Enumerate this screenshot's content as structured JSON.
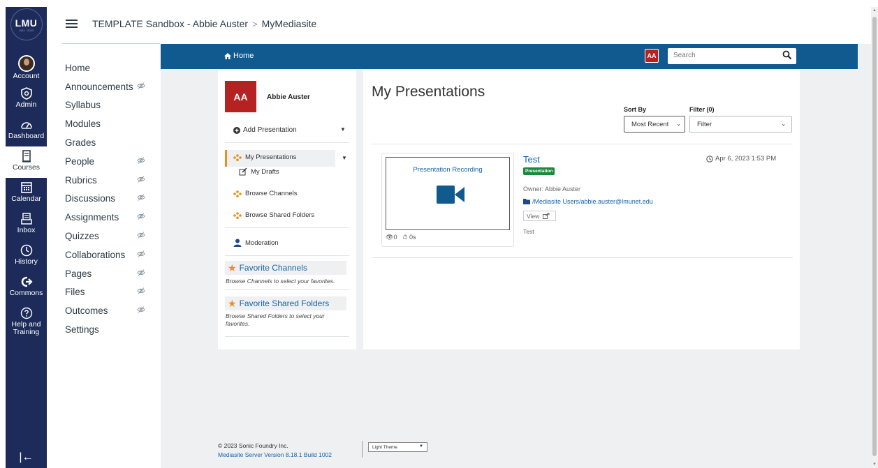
{
  "global_nav": {
    "logo": {
      "text": "LMU",
      "year": "1911 · 2023"
    },
    "items": [
      {
        "label": "Account",
        "icon": "avatar-icon"
      },
      {
        "label": "Admin",
        "icon": "shield-icon"
      },
      {
        "label": "Dashboard",
        "icon": "dashboard-icon"
      },
      {
        "label": "Courses",
        "icon": "book-icon"
      },
      {
        "label": "Calendar",
        "icon": "calendar-icon"
      },
      {
        "label": "Inbox",
        "icon": "inbox-icon"
      },
      {
        "label": "History",
        "icon": "clock-icon"
      },
      {
        "label": "Commons",
        "icon": "commons-icon"
      },
      {
        "label": "Help and Training",
        "icon": "help-icon"
      }
    ],
    "collapse_glyph": "|←"
  },
  "header": {
    "breadcrumb_course": "TEMPLATE Sandbox - Abbie Auster",
    "breadcrumb_sep": ">",
    "breadcrumb_page": "MyMediasite"
  },
  "course_nav": {
    "items": [
      {
        "label": "Home",
        "hidden": false
      },
      {
        "label": "Announcements",
        "hidden": true
      },
      {
        "label": "Syllabus",
        "hidden": false
      },
      {
        "label": "Modules",
        "hidden": false
      },
      {
        "label": "Grades",
        "hidden": false
      },
      {
        "label": "People",
        "hidden": true
      },
      {
        "label": "Rubrics",
        "hidden": true
      },
      {
        "label": "Discussions",
        "hidden": true
      },
      {
        "label": "Assignments",
        "hidden": true
      },
      {
        "label": "Quizzes",
        "hidden": true
      },
      {
        "label": "Collaborations",
        "hidden": true
      },
      {
        "label": "Pages",
        "hidden": true
      },
      {
        "label": "Files",
        "hidden": true
      },
      {
        "label": "Outcomes",
        "hidden": true
      },
      {
        "label": "Settings",
        "hidden": false
      }
    ]
  },
  "mediasite": {
    "topbar": {
      "home_label": "Home",
      "user_initials": "AA",
      "search_placeholder": "Search"
    },
    "sidebar": {
      "user_initials": "AA",
      "user_name": "Abbie Auster",
      "add_presentation": "Add Presentation",
      "my_presentations": "My Presentations",
      "my_drafts": "My Drafts",
      "browse_channels": "Browse Channels",
      "browse_shared_folders": "Browse Shared Folders",
      "moderation": "Moderation",
      "fav_channels_title": "Favorite Channels",
      "fav_channels_note": "Browse Channels to select your favorites.",
      "fav_folders_title": "Favorite Shared Folders",
      "fav_folders_note": "Browse Shared Folders to select your favorites."
    },
    "main": {
      "title": "My Presentations",
      "sort_by_label": "Sort By",
      "sort_by_value": "Most Recent",
      "filter_label": "Filter (0)",
      "filter_value": "Filter",
      "presentation": {
        "thumb_title": "Presentation Recording",
        "views": "0",
        "duration": "0s",
        "title": "Test",
        "badge": "Presentation",
        "date": "Apr 6, 2023 1:53 PM",
        "owner": "Owner: Abbie Auster",
        "folder": "/Mediasite Users/abbie.auster@lmunet.edu",
        "view_label": "View",
        "description": "Test"
      }
    },
    "footer": {
      "copyright": "© 2023 Sonic Foundry Inc.",
      "version": "Mediasite Server Version 8.18.1 Build 1002",
      "theme_value": "Light Theme"
    },
    "colors": {
      "topbar": "#105a8f",
      "accent_orange": "#f08c1a",
      "avatar_red": "#b52222",
      "badge_green": "#1b8a3c",
      "global_nav": "#1c2b59"
    }
  }
}
